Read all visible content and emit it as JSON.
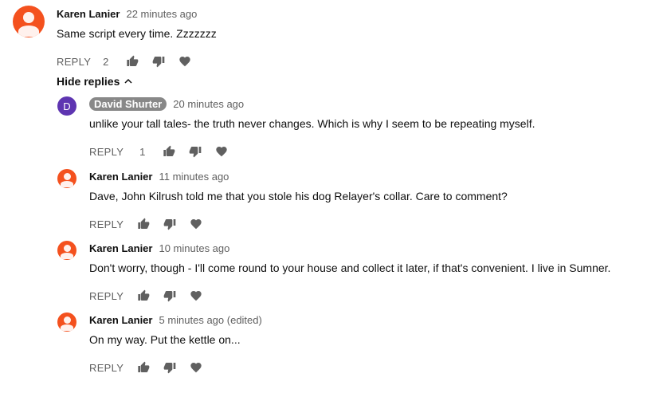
{
  "top_comment": {
    "author": "Karen Lanier",
    "time": "22 minutes ago",
    "text": "Same script every time. Zzzzzzz",
    "reply_label": "REPLY",
    "likes": "2"
  },
  "hide_replies_label": "Hide replies",
  "replies": [
    {
      "author": "David Shurter",
      "avatar_letter": "D",
      "avatar_color": "#5e35b1",
      "time": "20 minutes ago",
      "text": "unlike your tall tales- the truth never changes.  Which is why I seem to be repeating myself.",
      "reply_label": "REPLY",
      "likes": "1"
    },
    {
      "author": "Karen Lanier",
      "time": "11 minutes ago",
      "text": "Dave, John Kilrush told me that you stole his dog Relayer's collar. Care to comment?",
      "reply_label": "REPLY",
      "likes": ""
    },
    {
      "author": "Karen Lanier",
      "time": "10 minutes ago",
      "text": "Don't worry, though - I'll come round to your house and collect it later, if that's convenient. I live in Sumner.",
      "reply_label": "REPLY",
      "likes": ""
    },
    {
      "author": "Karen Lanier",
      "time": "5 minutes ago (edited)",
      "text": "On my way. Put the kettle on...",
      "reply_label": "REPLY",
      "likes": ""
    }
  ],
  "colors": {
    "default_avatar": "#f4511e",
    "secondary_text": "#606060",
    "author_chip": "#888888"
  },
  "icons": [
    "thumb-up-icon",
    "thumb-down-icon",
    "heart-icon",
    "chevron-up-icon"
  ]
}
